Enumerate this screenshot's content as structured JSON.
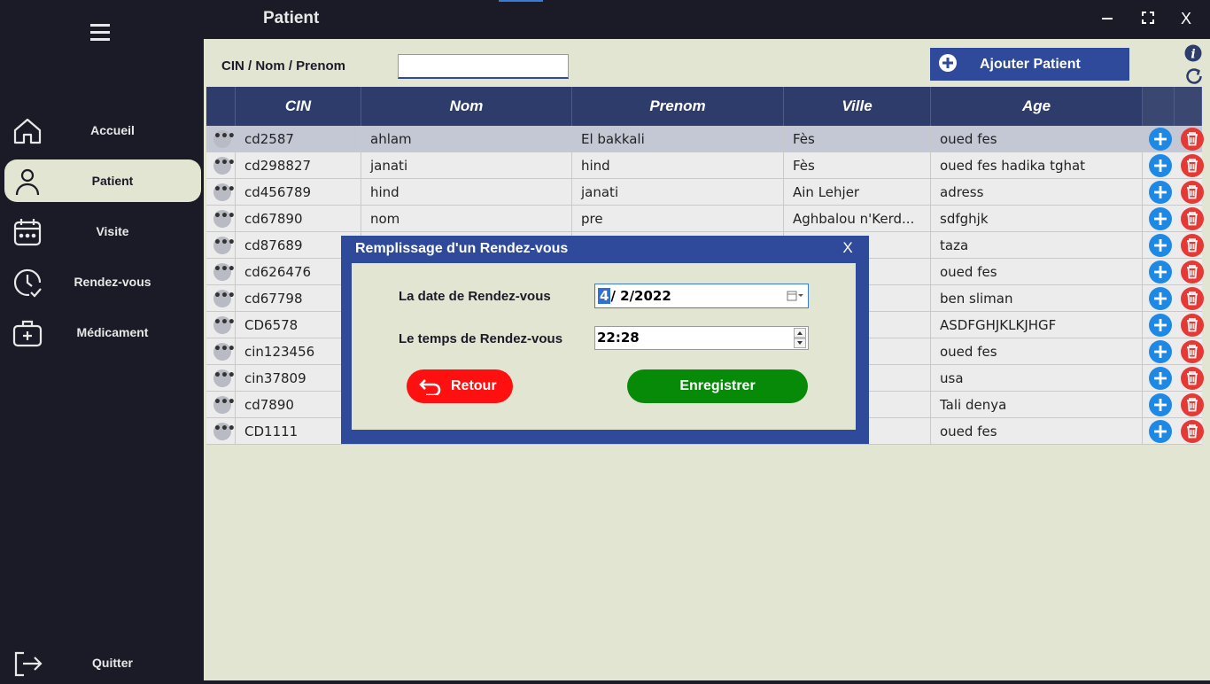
{
  "window": {
    "title": "Patient",
    "minimize": "–",
    "maximize": "⛶",
    "close": "X"
  },
  "sidebar": {
    "items": [
      {
        "label": "Accueil",
        "icon": "home-icon",
        "active": false
      },
      {
        "label": "Patient",
        "icon": "user-icon",
        "active": true
      },
      {
        "label": "Visite",
        "icon": "calendar-icon",
        "active": false
      },
      {
        "label": "Rendez-vous",
        "icon": "clock-check-icon",
        "active": false
      },
      {
        "label": "Médicament",
        "icon": "medical-bag-icon",
        "active": false
      }
    ],
    "quit_label": "Quitter"
  },
  "search": {
    "label": "CIN / Nom / Prenom",
    "value": ""
  },
  "add_patient_label": "Ajouter Patient",
  "table": {
    "columns": [
      "CIN",
      "Nom",
      "Prenom",
      "Ville",
      "Age"
    ],
    "rows": [
      {
        "cin": "cd2587",
        "nom": "ahlam",
        "prenom": "El bakkali",
        "ville": "Fès",
        "age": "oued fes",
        "selected": true
      },
      {
        "cin": "cd298827",
        "nom": "janati",
        "prenom": "hind",
        "ville": "Fès",
        "age": "oued fes hadika tghat"
      },
      {
        "cin": "cd456789",
        "nom": "hind",
        "prenom": "janati",
        "ville": "Ain Lehjer",
        "age": "adress"
      },
      {
        "cin": "cd67890",
        "nom": "nom",
        "prenom": "pre",
        "ville": "Aghbalou n'Kerd...",
        "age": "sdfghjk"
      },
      {
        "cin": "cd87689",
        "nom": "",
        "prenom": "",
        "ville": "",
        "age": "taza"
      },
      {
        "cin": "cd626476",
        "nom": "",
        "prenom": "",
        "ville": "",
        "age": "oued fes"
      },
      {
        "cin": "cd67798",
        "nom": "",
        "prenom": "",
        "ville": "",
        "age": "ben sliman"
      },
      {
        "cin": "CD6578",
        "nom": "",
        "prenom": "",
        "ville": "",
        "age": "ASDFGHJKLKJHGF"
      },
      {
        "cin": "cin123456",
        "nom": "",
        "prenom": "",
        "ville": "",
        "age": "oued fes"
      },
      {
        "cin": "cin37809",
        "nom": "",
        "prenom": "",
        "ville": "",
        "age": "usa"
      },
      {
        "cin": "cd7890",
        "nom": "",
        "prenom": "",
        "ville": "",
        "age": "Tali denya"
      },
      {
        "cin": "CD1111",
        "nom": "",
        "prenom": "",
        "ville": "",
        "age": "oued fes"
      }
    ]
  },
  "modal": {
    "title": "Remplissage d'un Rendez-vous",
    "close": "X",
    "date_label": "La date de Rendez-vous",
    "date_day": "4",
    "date_rest": "/  2/2022",
    "time_label": "Le temps de Rendez-vous",
    "time_value": "22:28",
    "back_label": "Retour",
    "save_label": "Enregistrer"
  },
  "colors": {
    "sidebar": "#1b1b27",
    "main": "#e3e5d3",
    "header": "#2d3c6b",
    "modal": "#2f4a9a",
    "save": "#078a07",
    "back": "#ff1010",
    "add": "#1e88e5",
    "delete": "#e53935"
  }
}
